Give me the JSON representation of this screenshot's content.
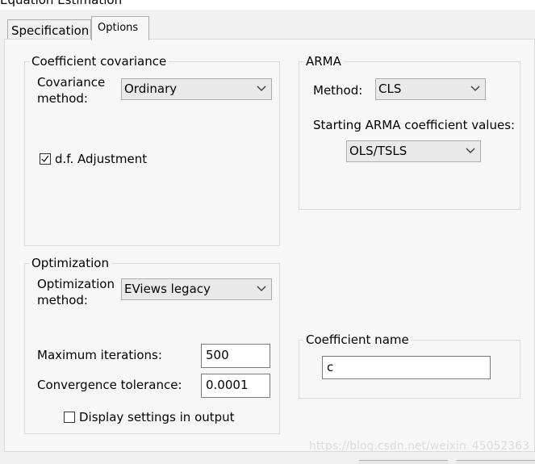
{
  "window": {
    "title": "Equation Estimation"
  },
  "tabs": [
    {
      "label": "Specification"
    },
    {
      "label": "Options"
    }
  ],
  "coef_cov": {
    "legend": "Coefficient covariance",
    "method_label_1": "Covariance",
    "method_label_2": "method:",
    "method_value": "Ordinary",
    "df_adjust_label": "d.f. Adjustment",
    "df_adjust_checked": true
  },
  "arma": {
    "legend": "ARMA",
    "method_label": "Method:",
    "method_value": "CLS",
    "start_label": "Starting ARMA coefficient values:",
    "start_value": "OLS/TSLS"
  },
  "optimization": {
    "legend": "Optimization",
    "method_label_1": "Optimization",
    "method_label_2": "method:",
    "method_value": "EViews legacy",
    "max_iter_label": "Maximum iterations:",
    "max_iter_value": "500",
    "conv_tol_label": "Convergence tolerance:",
    "conv_tol_value": "0.0001",
    "display_label": "Display settings in output",
    "display_checked": false
  },
  "coef_name": {
    "legend": "Coefficient name",
    "value": "c"
  },
  "watermark": "https://blog.csdn.net/weixin_45052363",
  "icons": {
    "dropdown": "chevron-down-icon",
    "check": "checkmark-icon"
  }
}
